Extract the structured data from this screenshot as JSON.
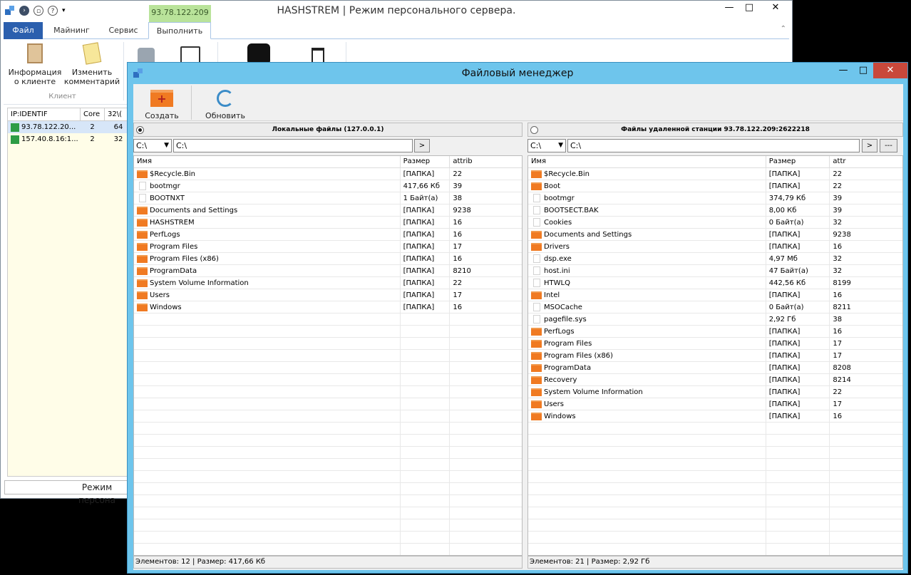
{
  "main_window": {
    "title": "HASHSTREM | Режим персонального сервера.",
    "ip_tag": "93.78.122.209",
    "tabs": [
      "Файл",
      "Майнинг",
      "Сервис",
      "Выполнить"
    ],
    "ribbon_buttons": [
      {
        "label": "Информация\nо клиенте",
        "icon": "clipboard-icon"
      },
      {
        "label": "Изменить\nкомментарий",
        "icon": "edit-comment-icon"
      }
    ],
    "ribbon_group_label": "Клиент",
    "grid_headers": [
      "IP:IDENTIF",
      "Core",
      "32\\("
    ],
    "grid_rows": [
      {
        "ip": "93.78.122.20...",
        "core": "2",
        "bits": "64"
      },
      {
        "ip": "157.40.8.16:1...",
        "core": "2",
        "bits": "32"
      }
    ],
    "status": "Режим персона"
  },
  "file_manager": {
    "title": "Файловый менеджер",
    "toolbar": {
      "create_folder": "Создать папку",
      "refresh": "Обновить"
    },
    "local": {
      "header": "Локальные файлы (127.0.0.1)",
      "drive": "C:\\",
      "path": "C:\\",
      "go": ">",
      "columns": [
        "Имя",
        "Размер",
        "attrib"
      ],
      "rows": [
        {
          "name": "$Recycle.Bin",
          "size": "[ПАПКА]",
          "attr": "22",
          "folder": true
        },
        {
          "name": "bootmgr",
          "size": "417,66 Кб",
          "attr": "39",
          "folder": false
        },
        {
          "name": "BOOTNXT",
          "size": "1 Байт(а)",
          "attr": "38",
          "folder": false
        },
        {
          "name": "Documents and Settings",
          "size": "[ПАПКА]",
          "attr": "9238",
          "folder": true
        },
        {
          "name": "HASHSTREM",
          "size": "[ПАПКА]",
          "attr": "16",
          "folder": true
        },
        {
          "name": "PerfLogs",
          "size": "[ПАПКА]",
          "attr": "16",
          "folder": true
        },
        {
          "name": "Program Files",
          "size": "[ПАПКА]",
          "attr": "17",
          "folder": true
        },
        {
          "name": "Program Files (x86)",
          "size": "[ПАПКА]",
          "attr": "16",
          "folder": true
        },
        {
          "name": "ProgramData",
          "size": "[ПАПКА]",
          "attr": "8210",
          "folder": true
        },
        {
          "name": "System Volume Information",
          "size": "[ПАПКА]",
          "attr": "22",
          "folder": true
        },
        {
          "name": "Users",
          "size": "[ПАПКА]",
          "attr": "17",
          "folder": true
        },
        {
          "name": "Windows",
          "size": "[ПАПКА]",
          "attr": "16",
          "folder": true
        }
      ],
      "status": "Элементов: 12 | Размер: 417,66 Кб"
    },
    "remote": {
      "header": "Файлы удаленной станции 93.78.122.209:2622218",
      "drive": "C:\\",
      "path": "C:\\",
      "go": ">",
      "extra": "---",
      "columns": [
        "Имя",
        "Размер",
        "attr"
      ],
      "rows": [
        {
          "name": "$Recycle.Bin",
          "size": "[ПАПКА]",
          "attr": "22",
          "folder": true
        },
        {
          "name": "Boot",
          "size": "[ПАПКА]",
          "attr": "22",
          "folder": true
        },
        {
          "name": "bootmgr",
          "size": "374,79 Кб",
          "attr": "39",
          "folder": false
        },
        {
          "name": "BOOTSECT.BAK",
          "size": "8,00 Кб",
          "attr": "39",
          "folder": false
        },
        {
          "name": "Cookies",
          "size": "0 Байт(а)",
          "attr": "32",
          "folder": false
        },
        {
          "name": "Documents and Settings",
          "size": "[ПАПКА]",
          "attr": "9238",
          "folder": true
        },
        {
          "name": "Drivers",
          "size": "[ПАПКА]",
          "attr": "16",
          "folder": true
        },
        {
          "name": "dsp.exe",
          "size": "4,97 Мб",
          "attr": "32",
          "folder": false
        },
        {
          "name": "host.ini",
          "size": "47 Байт(а)",
          "attr": "32",
          "folder": false
        },
        {
          "name": "HTWLQ",
          "size": "442,56 Кб",
          "attr": "8199",
          "folder": false
        },
        {
          "name": "Intel",
          "size": "[ПАПКА]",
          "attr": "16",
          "folder": true
        },
        {
          "name": "MSOCache",
          "size": "0 Байт(а)",
          "attr": "8211",
          "folder": false
        },
        {
          "name": "pagefile.sys",
          "size": "2,92 Гб",
          "attr": "38",
          "folder": false
        },
        {
          "name": "PerfLogs",
          "size": "[ПАПКА]",
          "attr": "16",
          "folder": true
        },
        {
          "name": "Program Files",
          "size": "[ПАПКА]",
          "attr": "17",
          "folder": true
        },
        {
          "name": "Program Files (x86)",
          "size": "[ПАПКА]",
          "attr": "17",
          "folder": true
        },
        {
          "name": "ProgramData",
          "size": "[ПАПКА]",
          "attr": "8208",
          "folder": true
        },
        {
          "name": "Recovery",
          "size": "[ПАПКА]",
          "attr": "8214",
          "folder": true
        },
        {
          "name": "System Volume Information",
          "size": "[ПАПКА]",
          "attr": "22",
          "folder": true
        },
        {
          "name": "Users",
          "size": "[ПАПКА]",
          "attr": "17",
          "folder": true
        },
        {
          "name": "Windows",
          "size": "[ПАПКА]",
          "attr": "16",
          "folder": true
        }
      ],
      "status": "Элементов: 21 | Размер: 2,92 Гб"
    }
  }
}
